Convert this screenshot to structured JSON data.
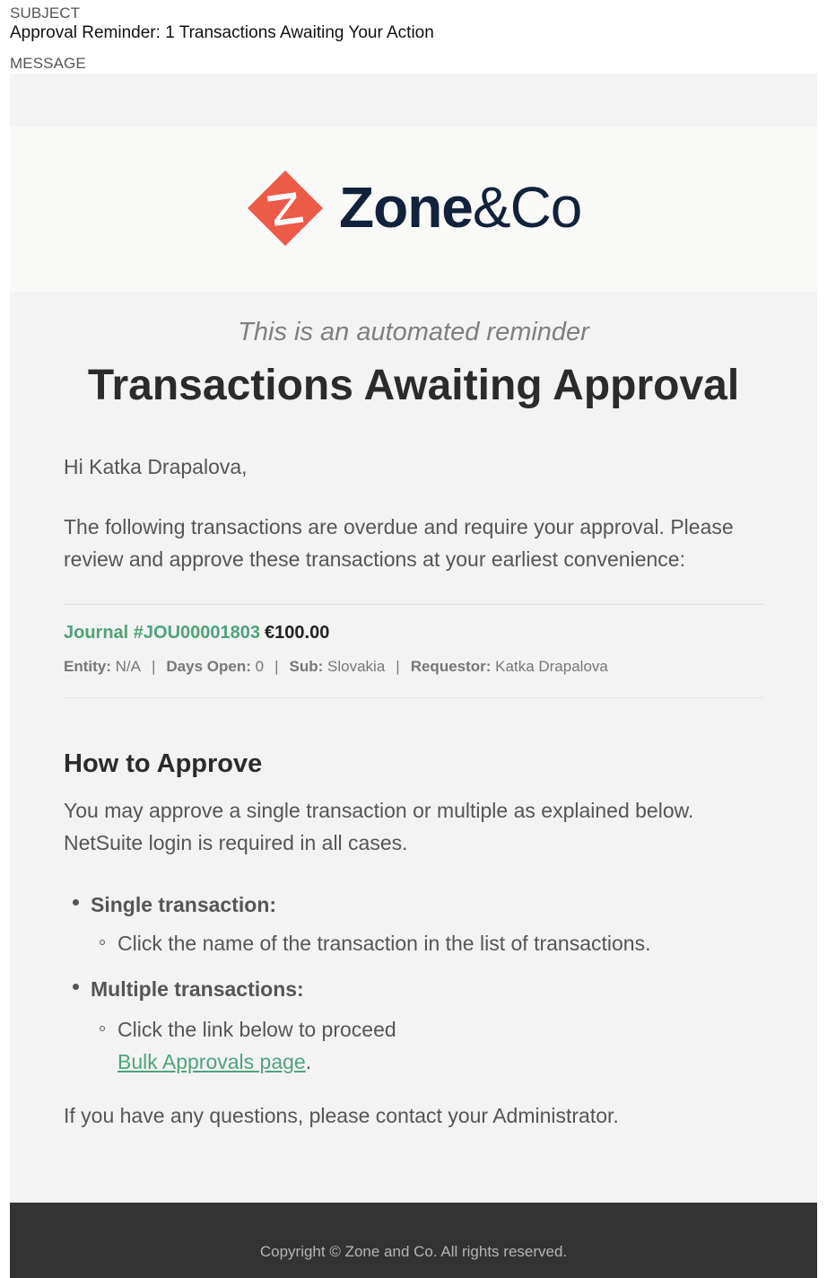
{
  "header": {
    "subject_label": "SUBJECT",
    "subject": "Approval Reminder: 1 Transactions Awaiting Your Action",
    "message_label": "MESSAGE"
  },
  "brand": {
    "logo_icon": "zone-diamond-z-icon",
    "name_bold": "Zone",
    "name_light": "&Co",
    "logo_color": "#ec5a48",
    "text_color": "#13223b"
  },
  "email": {
    "tagline": "This is an automated reminder",
    "headline": "Transactions Awaiting Approval",
    "greeting": "Hi Katka Drapalova,",
    "intro": "The following transactions are overdue and require your approval. Please review and approve these transactions at your earliest convenience:",
    "transactions": [
      {
        "link_text": "Journal #JOU00001803",
        "amount": "€100.00",
        "entity_label": "Entity:",
        "entity": "N/A",
        "days_open_label": "Days Open:",
        "days_open": "0",
        "sub_label": "Sub:",
        "sub": "Slovakia",
        "requestor_label": "Requestor:",
        "requestor": "Katka Drapalova",
        "separator": "|"
      }
    ],
    "howto_title": "How to Approve",
    "howto_intro": "You may approve a single transaction or multiple as explained below. NetSuite login is required in all cases.",
    "steps": [
      {
        "title": "Single transaction:",
        "detail": "Click the name of the transaction in the list of transactions."
      },
      {
        "title": "Multiple transactions:",
        "detail": "Click the link below to proceed",
        "link": "Bulk Approvals page",
        "link_suffix": "."
      }
    ],
    "outro": "If you have any questions, please contact your Administrator.",
    "copyright": "Copyright © Zone and Co. All rights reserved.",
    "accent_color": "#4ea478",
    "footer_color": "#333333"
  }
}
